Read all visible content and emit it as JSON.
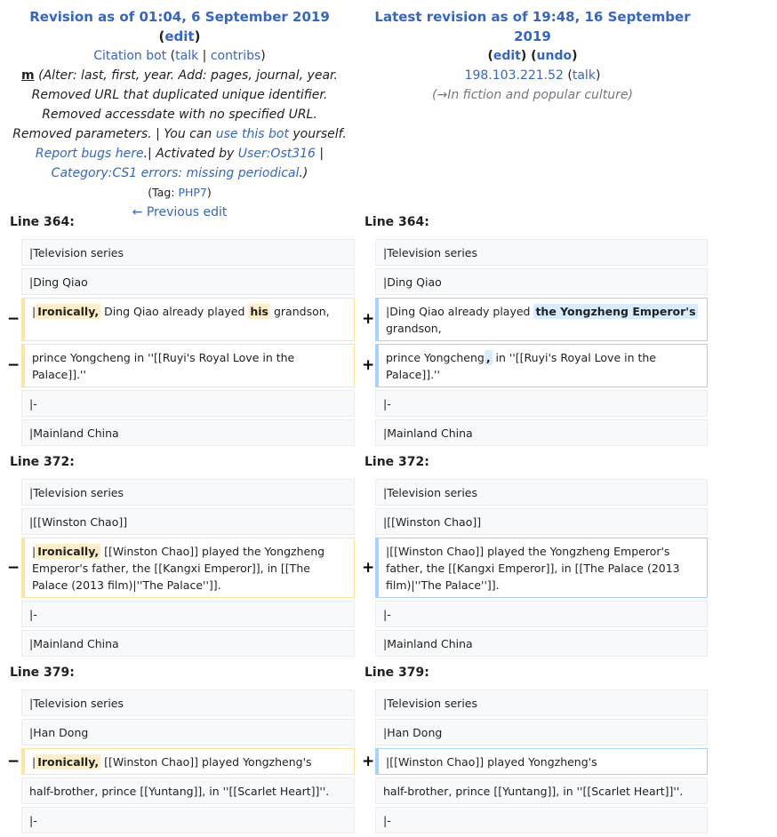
{
  "header_left": {
    "title_prefix": "Revision as of 01:04, 6 September 2019",
    "edit": "edit",
    "user": "Citation bot",
    "talk": "talk",
    "contribs": "contribs",
    "minor": "m",
    "summary_1": "Alter: last, first, year. Add: pages, journal, year. Removed URL that duplicated unique identifier. Removed accessdate with no specified URL. Removed parameters. | You can ",
    "summary_link_1": "use this bot",
    "summary_2": " yourself. ",
    "summary_link_2": "Report bugs here",
    "summary_3": ".| Activated by ",
    "summary_link_3": "User:Ost316",
    "summary_4": " | ",
    "summary_link_4": "Category:CS1 errors: missing periodical",
    "summary_5": ".",
    "tag_label": "Tag: ",
    "tag_value": "PHP7",
    "prev_edit": "← Previous edit"
  },
  "header_right": {
    "title": "Latest revision as of 19:48, 16 September 2019",
    "edit": "edit",
    "undo": "undo",
    "user": "198.103.221.52",
    "talk": "talk",
    "section_arrow": "→",
    "section": "In fiction and popular culture"
  },
  "diff": {
    "block1": {
      "label": "Line 364:",
      "l1": "|Television series",
      "l2": "|Ding Qiao",
      "del3_pre": "|",
      "del3_hl": "Ironically,",
      "del3_mid": " Ding Qiao already played ",
      "del3_hl2": "his",
      "del3_post": " grandson,",
      "add3_pre": "|Ding Qiao already played ",
      "add3_hl": "the Yongzheng Emperor's",
      "add3_post": " grandson,",
      "del4": "prince Yongcheng in ''[[Ruyi's Royal Love in the Palace]].''",
      "add4_pre": "prince Yongcheng",
      "add4_hl": ",",
      "add4_post": " in ''[[Ruyi's Royal Love in the Palace]].''",
      "l5": "|-",
      "l6": "|Mainland China"
    },
    "block2": {
      "label": "Line 372:",
      "l1": "|Television series",
      "l2": "|[[Winston Chao]]",
      "del3_pre": "|",
      "del3_hl": "Ironically,",
      "del3_post": " [[Winston Chao]] played the Yongzheng Emperor's father, the [[Kangxi Emperor]], in [[The Palace (2013 film)|''The Palace'']].",
      "add3": "|[[Winston Chao]] played the Yongzheng Emperor's father, the [[Kangxi Emperor]], in [[The Palace (2013 film)|''The Palace'']].",
      "l4": "|-",
      "l5": "|Mainland China"
    },
    "block3": {
      "label": "Line 379:",
      "l1": "|Television series",
      "l2": "|Han Dong",
      "del3_pre": "|",
      "del3_hl": "Ironically,",
      "del3_post": " [[Winston Chao]] played Yongzheng's",
      "add3": "|[[Winston Chao]] played Yongzheng's",
      "l4": "half-brother, prince [[Yuntang]], in ''[[Scarlet Heart]]''.",
      "l5": "|-"
    },
    "minus": "−",
    "plus": "+"
  }
}
